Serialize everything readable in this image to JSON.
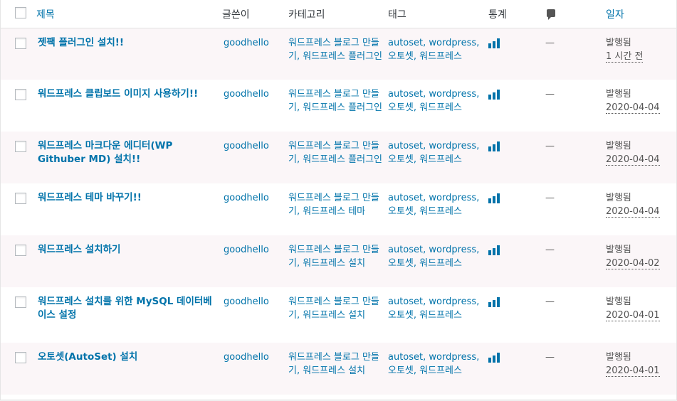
{
  "header": {
    "title": "제목",
    "author": "글쓴이",
    "categories": "카테고리",
    "tags": "태그",
    "stats": "통계",
    "date": "일자"
  },
  "rows": [
    {
      "title": "젯팩 플러그인 설치!!",
      "author": "goodhello",
      "categories": [
        "워드프레스 블로그 만들기",
        "워드프레스 플러그인"
      ],
      "tags": [
        "autoset",
        "wordpress",
        "오토셋",
        "워드프레스"
      ],
      "comments": "—",
      "status": "발행됨",
      "date": "1 시간 전"
    },
    {
      "title": "워드프레스 클립보드 이미지 사용하기!!",
      "author": "goodhello",
      "categories": [
        "워드프레스 블로그 만들기",
        "워드프레스 플러그인"
      ],
      "tags": [
        "autoset",
        "wordpress",
        "오토셋",
        "워드프레스"
      ],
      "comments": "—",
      "status": "발행됨",
      "date": "2020-04-04"
    },
    {
      "title": "워드프레스 마크다운 에디터(WP Githuber MD) 설치!!",
      "author": "goodhello",
      "categories": [
        "워드프레스 블로그 만들기",
        "워드프레스 플러그인"
      ],
      "tags": [
        "autoset",
        "wordpress",
        "오토셋",
        "워드프레스"
      ],
      "comments": "—",
      "status": "발행됨",
      "date": "2020-04-04"
    },
    {
      "title": "워드프레스 테마 바꾸기!!",
      "author": "goodhello",
      "categories": [
        "워드프레스 블로그 만들기",
        "워드프레스 테마"
      ],
      "tags": [
        "autoset",
        "wordpress",
        "오토셋",
        "워드프레스"
      ],
      "comments": "—",
      "status": "발행됨",
      "date": "2020-04-04"
    },
    {
      "title": "워드프레스 설치하기",
      "author": "goodhello",
      "categories": [
        "워드프레스 블로그 만들기",
        "워드프레스 설치"
      ],
      "tags": [
        "autoset",
        "wordpress",
        "오토셋",
        "워드프레스"
      ],
      "comments": "—",
      "status": "발행됨",
      "date": "2020-04-02"
    },
    {
      "title": "워드프레스 설치를 위한 MySQL 데이터베이스 설정",
      "author": "goodhello",
      "categories": [
        "워드프레스 블로그 만들기",
        "워드프레스 설치"
      ],
      "tags": [
        "autoset",
        "wordpress",
        "오토셋",
        "워드프레스"
      ],
      "comments": "—",
      "status": "발행됨",
      "date": "2020-04-01"
    },
    {
      "title": "오토셋(AutoSet) 설치",
      "author": "goodhello",
      "categories": [
        "워드프레스 블로그 만들기",
        "워드프레스 설치"
      ],
      "tags": [
        "autoset",
        "wordpress",
        "오토셋",
        "워드프레스"
      ],
      "comments": "—",
      "status": "발행됨",
      "date": "2020-04-01"
    }
  ],
  "colors": {
    "link": "#0073aa",
    "text": "#555555",
    "row_alt": "#fbf6f8"
  },
  "icons": {
    "stats": "bar-chart-icon",
    "comments": "comment-bubble-icon"
  }
}
